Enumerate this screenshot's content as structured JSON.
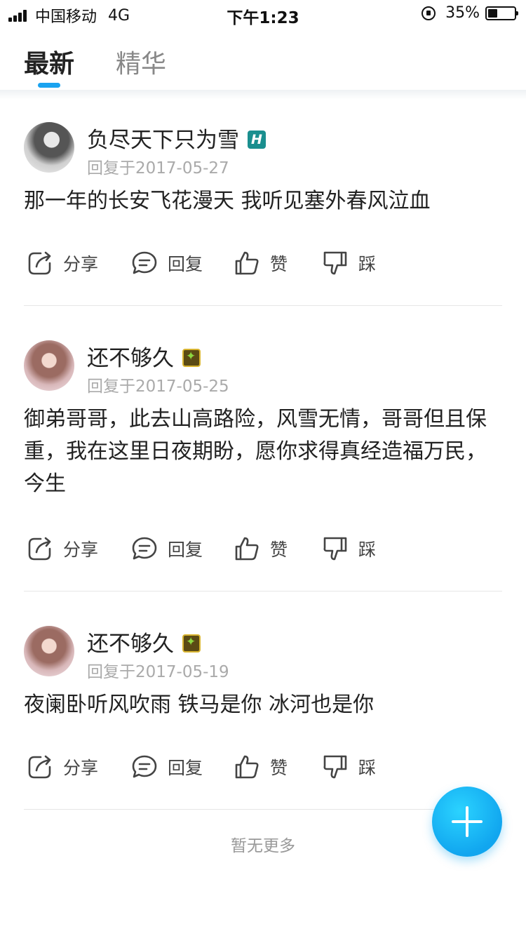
{
  "status_bar": {
    "carrier": "中国移动",
    "network": "4G",
    "time": "下午1:23",
    "battery_percent": "35%",
    "battery_level": 0.35
  },
  "tabs": {
    "latest": "最新",
    "featured": "精华",
    "active": "latest",
    "accent_color": "#1aa3f0"
  },
  "actions": {
    "share": "分享",
    "reply": "回复",
    "like": "赞",
    "dislike": "踩"
  },
  "posts": [
    {
      "author": "负尽天下只为雪",
      "badge": "H",
      "date": "回复于2017-05-27",
      "content": "那一年的长安飞花漫天 我听见塞外春风泣血"
    },
    {
      "author": "还不够久",
      "badge": "star-badge-icon",
      "date": "回复于2017-05-25",
      "content": "御弟哥哥，此去山高路险，风雪无情，哥哥但且保重，我在这里日夜期盼，愿你求得真经造福万民，今生"
    },
    {
      "author": "还不够久",
      "badge": "star-badge-icon",
      "date": "回复于2017-05-19",
      "content": "夜阑卧听风吹雨 铁马是你 冰河也是你"
    }
  ],
  "footer": {
    "no_more": "暂无更多"
  },
  "fab": {
    "icon": "plus-icon",
    "color": "#11a6ef"
  }
}
